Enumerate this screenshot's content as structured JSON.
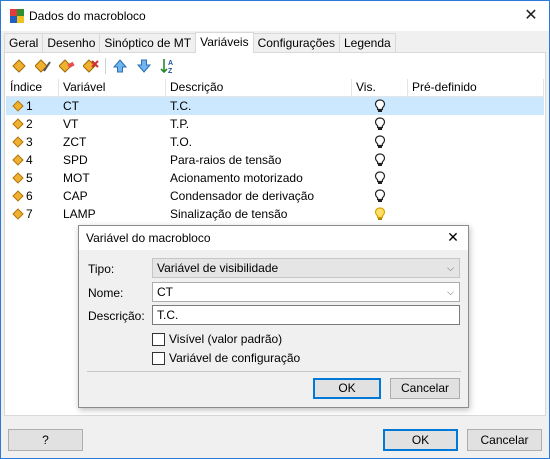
{
  "window": {
    "title": "Dados do macrobloco",
    "close": "✕"
  },
  "tabs": [
    {
      "label": "Geral"
    },
    {
      "label": "Desenho"
    },
    {
      "label": "Sinóptico de MT"
    },
    {
      "label": "Variáveis"
    },
    {
      "label": "Configurações"
    },
    {
      "label": "Legenda"
    }
  ],
  "active_tab": "Variáveis",
  "toolbar": {
    "icons": [
      "add-variable-icon",
      "edit-variable-icon",
      "clear-variable-icon",
      "delete-variable-icon",
      "move-up-icon",
      "move-down-icon",
      "sort-az-icon"
    ]
  },
  "grid": {
    "headers": [
      "Índice",
      "Variável",
      "Descrição",
      "Vis.",
      "Pré-definido"
    ],
    "rows": [
      {
        "index": "1",
        "variable": "CT",
        "description": "T.C.",
        "vis": "bulb-off",
        "predefined": ""
      },
      {
        "index": "2",
        "variable": "VT",
        "description": "T.P.",
        "vis": "bulb-off",
        "predefined": ""
      },
      {
        "index": "3",
        "variable": "ZCT",
        "description": "T.O.",
        "vis": "bulb-off",
        "predefined": ""
      },
      {
        "index": "4",
        "variable": "SPD",
        "description": "Para-raios de tensão",
        "vis": "bulb-off",
        "predefined": ""
      },
      {
        "index": "5",
        "variable": "MOT",
        "description": "Acionamento motorizado",
        "vis": "bulb-off",
        "predefined": ""
      },
      {
        "index": "6",
        "variable": "CAP",
        "description": "Condensador de derivação",
        "vis": "bulb-off",
        "predefined": ""
      },
      {
        "index": "7",
        "variable": "LAMP",
        "description": "Sinalização de tensão",
        "vis": "bulb-on",
        "predefined": ""
      }
    ],
    "selected_row": 0
  },
  "buttons": {
    "help": "?",
    "ok": "OK",
    "cancel": "Cancelar"
  },
  "dialog": {
    "title": "Variável do macrobloco",
    "close": "✕",
    "type_label": "Tipo:",
    "type_value": "Variável de visibilidade",
    "name_label": "Nome:",
    "name_value": "CT",
    "description_label": "Descrição:",
    "description_value": "T.C.",
    "visible_label": "Visível (valor padrão)",
    "visible_checked": false,
    "config_label": "Variável de configuração",
    "config_checked": false,
    "ok": "OK",
    "cancel": "Cancelar"
  },
  "colors": {
    "accent": "#0078d7",
    "selection": "#cce8ff",
    "window_border": "#2b79d8"
  }
}
